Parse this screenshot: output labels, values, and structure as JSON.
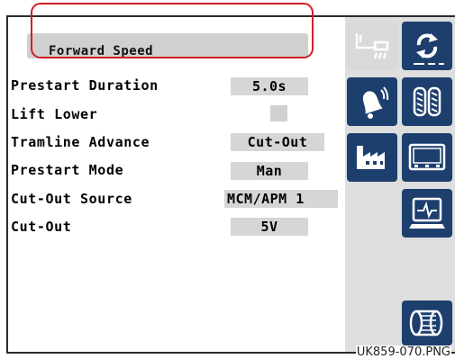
{
  "dropdown": {
    "label": "Forward Speed"
  },
  "settings": [
    {
      "label": "Prestart Duration",
      "value": "5.0s"
    },
    {
      "label": "Lift Lower",
      "value": ""
    },
    {
      "label": "Tramline Advance",
      "value": "Cut-Out"
    },
    {
      "label": "Prestart Mode",
      "value": "Man"
    },
    {
      "label": "Cut-Out Source",
      "value": "MCM/APM 1"
    },
    {
      "label": "Cut-Out",
      "value": "5V"
    }
  ],
  "sidebar": {
    "buttons": [
      {
        "icon": "seeder-icon"
      },
      {
        "icon": "refresh-icon"
      },
      {
        "icon": "alarm-bell-icon"
      },
      {
        "icon": "tramline-icon"
      },
      {
        "icon": "factory-icon"
      },
      {
        "icon": "display-monitor-icon"
      },
      {
        "icon": "diagnostics-monitor-icon"
      },
      {
        "icon": "metering-roller-icon"
      }
    ]
  },
  "caption": "UK859-070.PNG",
  "colors": {
    "button_blue": "#1d3f6e",
    "highlight_red": "#d21f26",
    "value_gray": "#d6d6d6"
  }
}
